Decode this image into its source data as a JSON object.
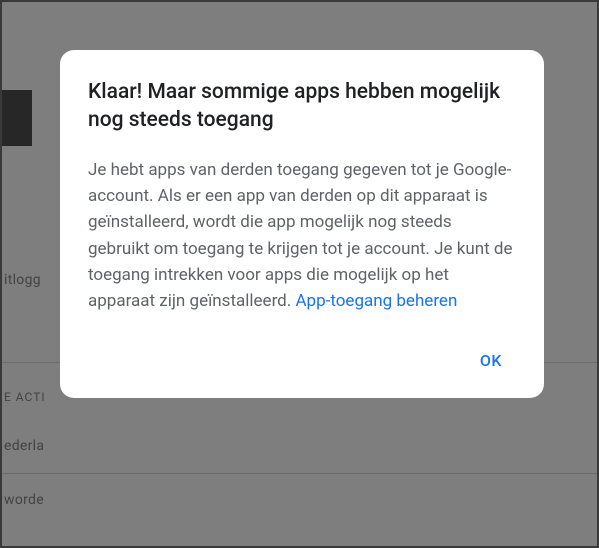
{
  "background": {
    "itlogg": "itlogg",
    "acti": "E ACTI",
    "ederla": "ederla",
    "worde": "worde"
  },
  "dialog": {
    "title": "Klaar! Maar sommige apps hebben mogelijk nog steeds toegang",
    "body": "Je hebt apps van derden toegang gegeven tot je Google-account. Als er een app van derden op dit apparaat is geïnstalleerd, wordt die app mogelijk nog steeds gebruikt om toegang te krijgen tot je account. Je kunt de toegang intrekken voor apps die mogelijk op het apparaat zijn geïnstalleerd. ",
    "link_text": "App-toegang beheren",
    "ok_label": "OK"
  }
}
